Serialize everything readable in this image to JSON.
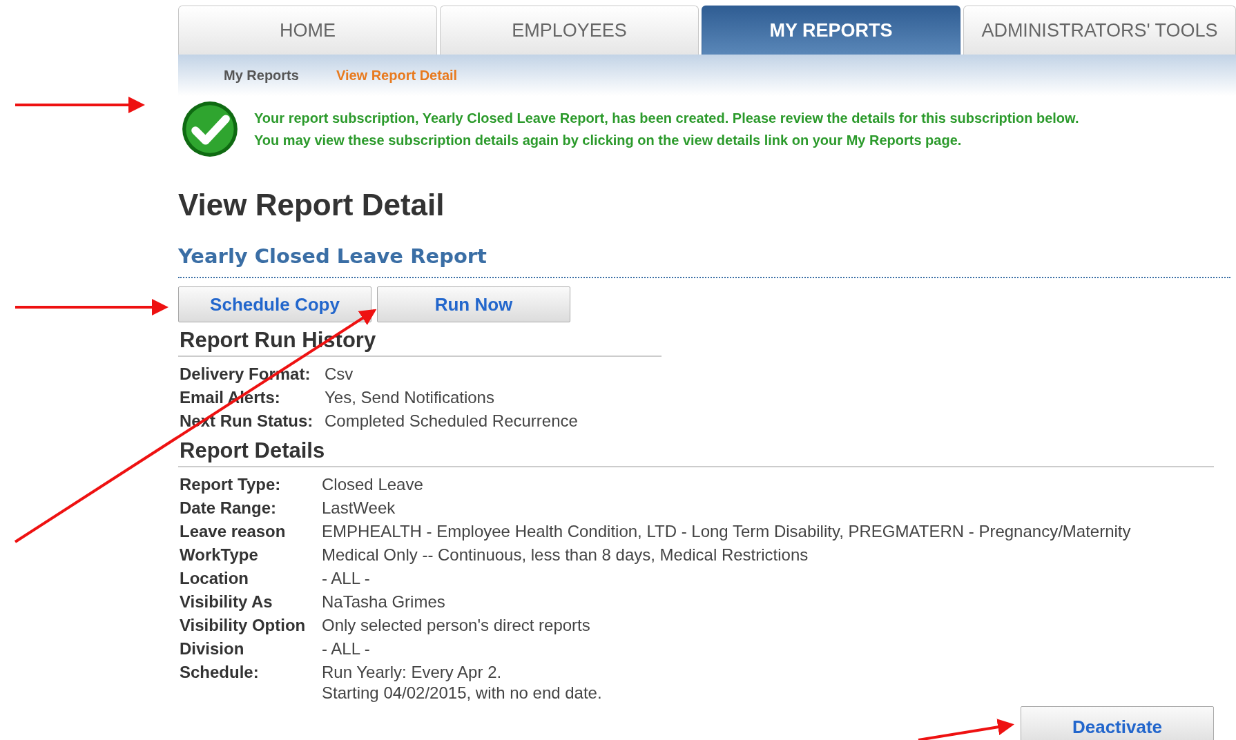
{
  "tabs": [
    {
      "label": "HOME",
      "selected": false
    },
    {
      "label": "EMPLOYEES",
      "selected": false
    },
    {
      "label": "MY REPORTS",
      "selected": true
    },
    {
      "label": "ADMINISTRATORS' TOOLS",
      "selected": false
    }
  ],
  "subnav": [
    {
      "label": "My Reports",
      "selected": false
    },
    {
      "label": "View Report Detail",
      "selected": true
    }
  ],
  "message": {
    "lines": [
      "Your report subscription, Yearly Closed Leave Report, has been created. Please review the details for this subscription below.",
      "You may view these subscription details again by clicking on the view details link on your My Reports page."
    ]
  },
  "page_title": "View Report Detail",
  "report_name": "Yearly Closed Leave Report",
  "actions": [
    "Schedule Copy",
    "Run Now"
  ],
  "run_history": {
    "title": "Report Run History",
    "rows": [
      {
        "label": "Delivery Format:",
        "value": "Csv"
      },
      {
        "label": "Email Alerts:",
        "value": "Yes, Send Notifications"
      },
      {
        "label": "Next Run Status:",
        "value": "Completed Scheduled Recurrence"
      }
    ]
  },
  "details": {
    "title": "Report Details",
    "rows": [
      {
        "label": "Report Type:",
        "value": [
          "Closed Leave"
        ]
      },
      {
        "label": "Date Range:",
        "value": [
          "LastWeek"
        ]
      },
      {
        "label": "Leave reason",
        "value": [
          "EMPHEALTH - Employee Health Condition, LTD - Long Term Disability, PREGMATERN - Pregnancy/Maternity"
        ]
      },
      {
        "label": "WorkType",
        "value": [
          "Medical Only -- Continuous, less than 8 days, Medical Restrictions"
        ]
      },
      {
        "label": "Location",
        "value": [
          "- ALL -"
        ]
      },
      {
        "label": "Visibility As",
        "value": [
          "NaTasha Grimes"
        ]
      },
      {
        "label": "Visibility Option",
        "value": [
          "Only selected person's direct reports"
        ]
      },
      {
        "label": "Division",
        "value": [
          "- ALL -"
        ]
      },
      {
        "label": "Schedule:",
        "value": [
          "Run Yearly: Every Apr 2.",
          "Starting 04/02/2015, with no end date."
        ]
      }
    ]
  },
  "deactivate_button": "Deactivate"
}
